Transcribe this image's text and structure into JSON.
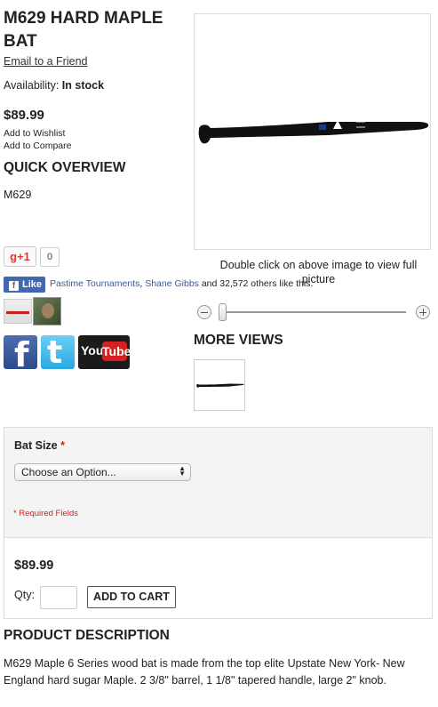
{
  "product": {
    "title": "M629 Hard Maple Bat",
    "email_link": "Email to a Friend",
    "availability_label": "Availability:",
    "availability_value": "In stock",
    "price": "$89.99",
    "wishlist": "Add to Wishlist",
    "compare": "Add to Compare"
  },
  "quick_overview": {
    "heading": "Quick Overview",
    "text": "M629"
  },
  "social": {
    "gplus_label": "+1",
    "gplus_count": "0",
    "fb_like": "Like",
    "fb_friend_1": "Pastime Tournaments",
    "fb_separator": ",",
    "fb_friend_2": "Shane Gibbs",
    "fb_rest": "and 32,572 others like this.",
    "facebook_icon": "facebook-icon",
    "twitter_icon": "twitter-icon",
    "youtube_you": "You",
    "youtube_tube": "Tube"
  },
  "gallery": {
    "hint": "Double click on above image to view full picture",
    "more_views_heading": "More Views"
  },
  "options": {
    "label": "Bat Size",
    "required_mark": "*",
    "select_value": "Choose an Option...",
    "required_note": "* Required Fields"
  },
  "cart": {
    "price": "$89.99",
    "qty_label": "Qty:",
    "qty_value": "",
    "add_button": "Add to Cart"
  },
  "description": {
    "heading": "Product Description",
    "text": "M629 Maple 6 Series wood bat is made from the top elite Upstate New York- New England hard sugar Maple. 2 3/8\" barrel, 1 1/8\" tapered handle, large 2\" knob."
  },
  "colors": {
    "fb_blue": "#4267b2",
    "required_red": "#d02020",
    "options_bg": "#f4f4f4"
  }
}
